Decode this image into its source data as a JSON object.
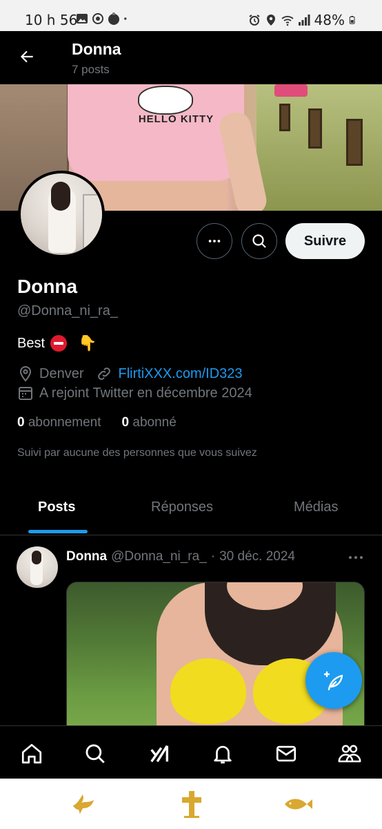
{
  "status_bar": {
    "time": "10 h 56",
    "battery": "48%"
  },
  "header": {
    "title": "Donna",
    "post_count": "7 posts"
  },
  "profile": {
    "follow_label": "Suivre",
    "name": "Donna",
    "handle": "@Donna_ni_ra_",
    "bio_text": "Best",
    "location": "Denver",
    "link": "FlirtiXXX.com/ID323",
    "joined": "A rejoint Twitter en décembre 2024",
    "following_count": "0",
    "following_label": "abonnement",
    "followers_count": "0",
    "followers_label": "abonné",
    "followed_by": "Suivi par aucune des personnes que vous suivez"
  },
  "tabs": [
    {
      "label": "Posts",
      "active": true
    },
    {
      "label": "Réponses",
      "active": false
    },
    {
      "label": "Médias",
      "active": false
    }
  ],
  "post": {
    "author": "Donna",
    "handle": "@Donna_ni_ra_",
    "separator": "·",
    "date": "30 déc. 2024"
  },
  "bottom_nav": [
    "home-icon",
    "search-icon",
    "grok-icon",
    "notifications-icon",
    "messages-icon",
    "communities-icon"
  ],
  "colors": {
    "accent": "#1d9bf0",
    "background": "#000000",
    "muted_text": "#71767b"
  }
}
